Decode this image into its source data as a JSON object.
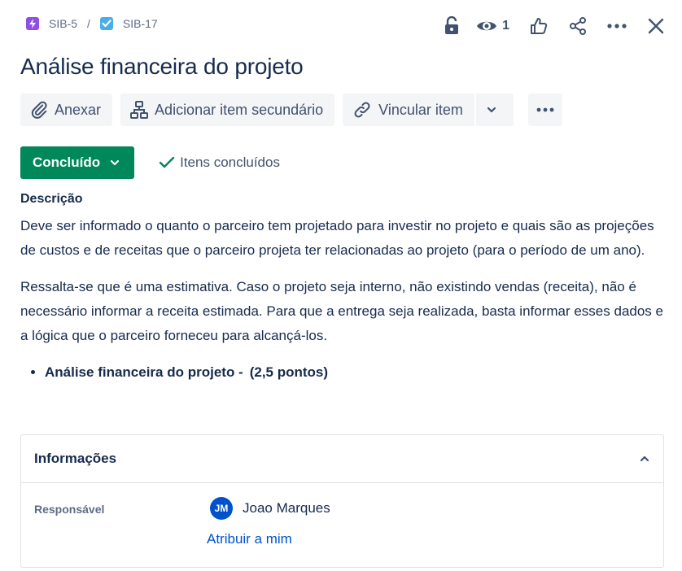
{
  "breadcrumb": {
    "parent": {
      "key": "SIB-5",
      "icon": "epic-icon",
      "color": "#904EE2"
    },
    "separator": "/",
    "current": {
      "key": "SIB-17",
      "icon": "task-checkbox-icon",
      "color": "#4BADE8"
    }
  },
  "header_actions": {
    "icons": [
      "unlock-icon",
      "eye-icon",
      "thumbs-up-icon",
      "share-icon",
      "more-icon",
      "close-icon"
    ],
    "watch_count": "1"
  },
  "issue": {
    "title": "Análise financeira do projeto"
  },
  "toolbar": {
    "attach": {
      "label": "Anexar",
      "icon": "paperclip-icon"
    },
    "child": {
      "label": "Adicionar item secundário",
      "icon": "hierarchy-icon"
    },
    "link": {
      "label": "Vincular item",
      "icon": "link-icon"
    }
  },
  "status": {
    "label": "Concluído",
    "color": "#00875A",
    "resolution": "Itens concluídos"
  },
  "description": {
    "label": "Descrição",
    "paragraphs": [
      "Deve ser informado o quanto o parceiro tem projetado para investir no projeto e quais são as projeções de custos e de receitas que o parceiro projeta ter relacionadas ao projeto (para o período de um ano).",
      "Ressalta-se que é uma estimativa. Caso o projeto seja interno, não existindo vendas (receita), não é necessário informar a receita estimada. Para que a entrega seja realizada, basta informar esses dados e a lógica que o parceiro forneceu para alcançá-los."
    ],
    "bullet": {
      "text": "Análise financeira do projeto -",
      "points": "(2,5 pontos)"
    }
  },
  "details": {
    "title": "Informações",
    "assignee_label": "Responsável",
    "assignee_initials": "JM",
    "assignee_name": "Joao Marques",
    "assign_to_me": "Atribuir a mim"
  }
}
